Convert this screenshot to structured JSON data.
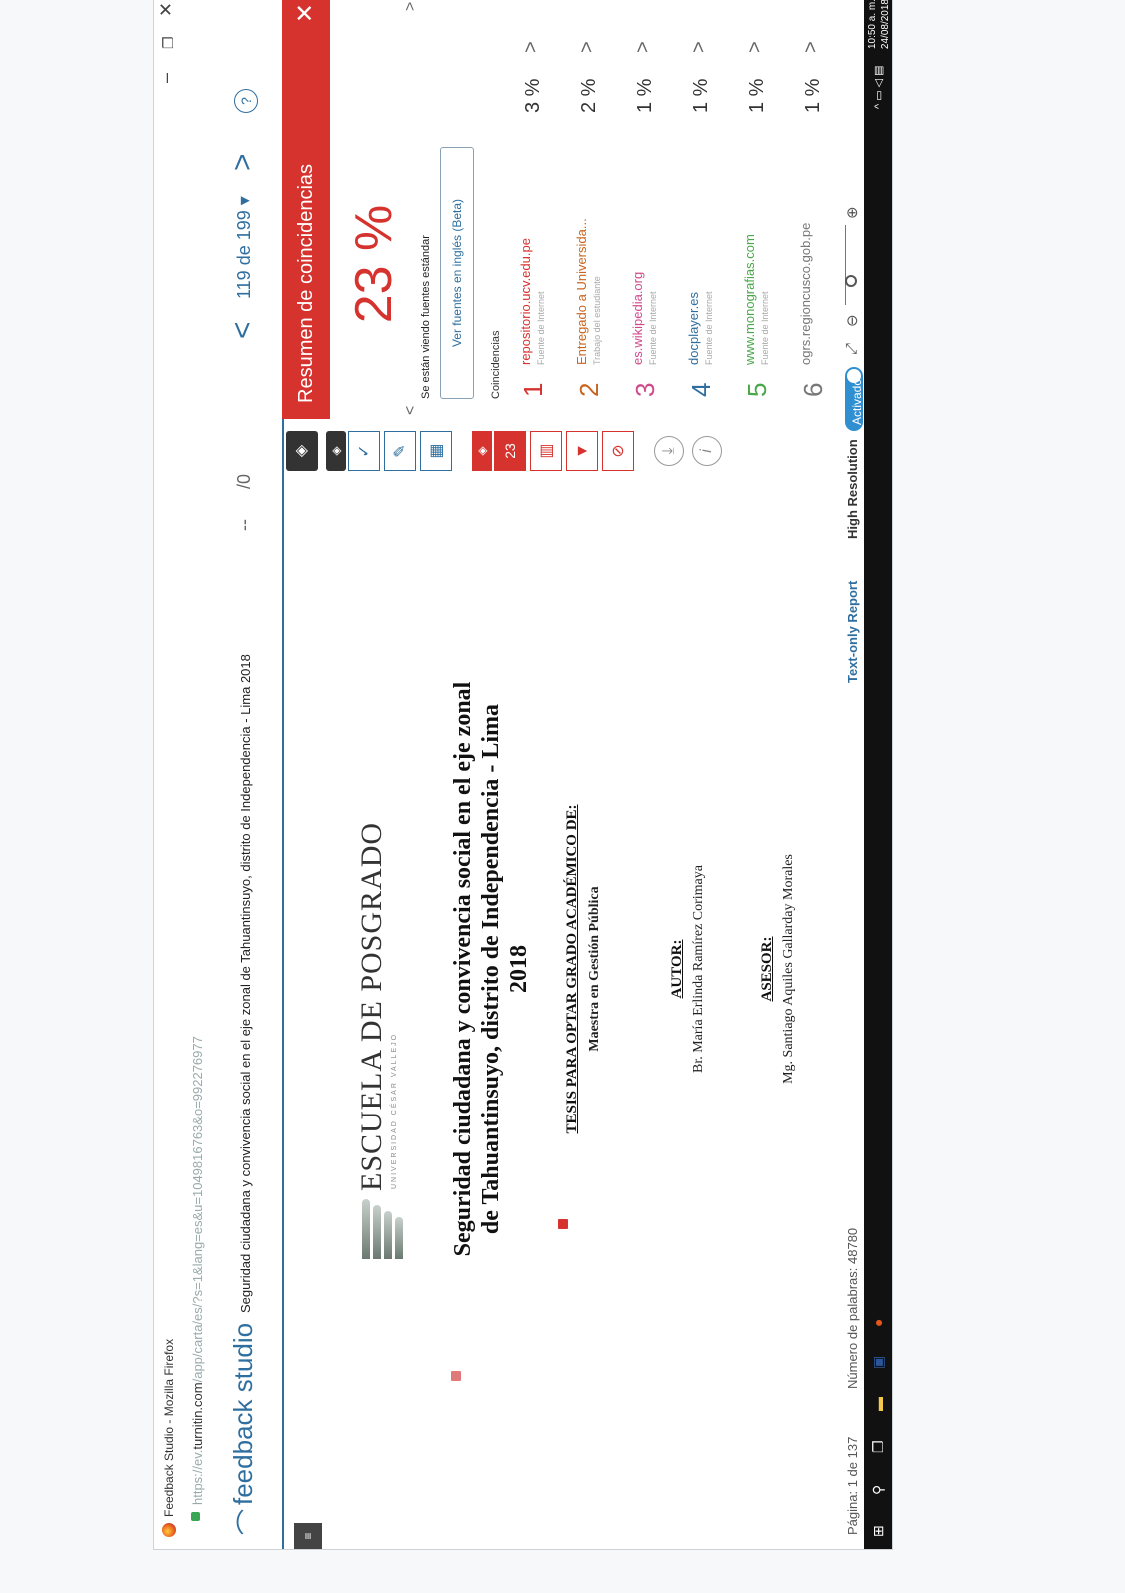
{
  "window": {
    "title": "Feedback Studio - Mozilla Firefox",
    "url_prefix": "https://ev.",
    "url_host": "turnitin.com",
    "url_rest": "/app/carta/es/?s=1&lang=es&u=1049816763&o=992276977"
  },
  "header": {
    "app_name": "feedback studio",
    "doc_title": "Seguridad ciudadana y convivencia social en el eje zonal de Tahuantinsuyo, distrito de Independencia - Lima 2018",
    "score_dashes": "--",
    "score_total": "/0",
    "page_nav": "119 de 199 ▾"
  },
  "document": {
    "school": "ESCUELA DE POSGRADO",
    "university": "UNIVERSIDAD CÉSAR VALLEJO",
    "title_lines": [
      "Seguridad ciudadana y convivencia social en el eje zonal",
      "de Tahuantinsuyo, distrito de Independencia - Lima",
      "2018"
    ],
    "tesis": "TESIS PARA OPTAR GRADO ACADÉMICO DE:",
    "degree": "Maestra en Gestión Pública",
    "autor_label": "AUTOR:",
    "autor": "Br. María Erlinda Ramírez Corimaya",
    "asesor_label": "ASESOR:",
    "asesor": "Mg. Santiago Aquiles Gallarday Morales",
    "marker_1": "1",
    "marker_2": "5"
  },
  "status": {
    "page": "Página: 1 de 137",
    "words": "Número de palabras: 48780",
    "text_only": "Text-only Report",
    "high_res": "High Resolution",
    "toggle": "Activado"
  },
  "taskbar": {
    "time": "10:50 a. m.",
    "date": "24/08/2018"
  },
  "toolbar": {
    "score_badge": "23"
  },
  "panel": {
    "title": "Resumen de coincidencias",
    "overall": "23 %",
    "viewing": "Se están viendo fuentes estándar",
    "english_btn": "Ver fuentes en inglés (Beta)",
    "matches_label": "Coincidencias",
    "matches": [
      {
        "num": "1",
        "source": "repositorio.ucv.edu.pe",
        "type": "Fuente de Internet",
        "pct": "3 %",
        "color": "#d6322e"
      },
      {
        "num": "2",
        "source": "Entregado a Universida...",
        "type": "Trabajo del estudiante",
        "pct": "2 %",
        "color": "#c9651e"
      },
      {
        "num": "3",
        "source": "es.wikipedia.org",
        "type": "Fuente de Internet",
        "pct": "1 %",
        "color": "#d04b8a"
      },
      {
        "num": "4",
        "source": "docplayer.es",
        "type": "Fuente de Internet",
        "pct": "1 %",
        "color": "#2f6f9f"
      },
      {
        "num": "5",
        "source": "www.monografias.com",
        "type": "Fuente de Internet",
        "pct": "1 %",
        "color": "#4aa84a"
      },
      {
        "num": "6",
        "source": "ogrs.regioncusco.gob.pe",
        "type": "",
        "pct": "1 %",
        "color": "#777777"
      }
    ]
  }
}
